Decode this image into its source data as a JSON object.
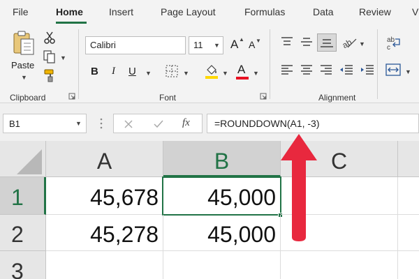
{
  "tabs": [
    {
      "label": "File",
      "active": false
    },
    {
      "label": "Home",
      "active": true
    },
    {
      "label": "Insert",
      "active": false
    },
    {
      "label": "Page Layout",
      "active": false
    },
    {
      "label": "Formulas",
      "active": false
    },
    {
      "label": "Data",
      "active": false
    },
    {
      "label": "Review",
      "active": false
    },
    {
      "label": "V",
      "active": false
    }
  ],
  "ribbon": {
    "clipboard": {
      "label": "Clipboard",
      "paste_label": "Paste"
    },
    "font": {
      "label": "Font",
      "family": "Calibri",
      "size": "11",
      "grow_label": "A",
      "shrink_label": "A",
      "bold": "B",
      "italic": "I",
      "underline": "U",
      "font_color_label": "A"
    },
    "alignment": {
      "label": "Alignment"
    },
    "colors": {
      "accent": "#217346",
      "font_color": "#e81123",
      "fill_color": "#ffd800"
    }
  },
  "formula_bar": {
    "name_box": "B1",
    "fx_label": "fx",
    "formula": "=ROUNDDOWN(A1, -3)"
  },
  "sheet": {
    "columns": [
      "A",
      "B",
      "C"
    ],
    "rows": [
      "1",
      "2",
      "3"
    ],
    "cells": [
      [
        "45,678",
        "45,000",
        ""
      ],
      [
        "45,278",
        "45,000",
        ""
      ],
      [
        "",
        "",
        ""
      ]
    ],
    "selected_cell": "B1"
  },
  "annotation": {
    "arrow_color": "#e8283e"
  }
}
